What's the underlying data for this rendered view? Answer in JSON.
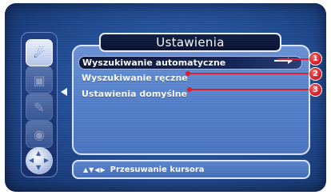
{
  "menu": {
    "title": "Ustawienia",
    "items": [
      {
        "label": "Wyszukiwanie automatyczne",
        "selected": true
      },
      {
        "label": "Wyszukiwanie ręczne",
        "selected": false
      },
      {
        "label": "Ustawienia domyślne",
        "selected": false
      }
    ]
  },
  "sidebar": {
    "icons": [
      {
        "name": "satellite-dish-icon",
        "glyph": "☄",
        "active": true
      },
      {
        "name": "tv-icon",
        "glyph": "▣",
        "active": false
      },
      {
        "name": "tools-icon",
        "glyph": "✎",
        "active": false
      },
      {
        "name": "settings-disk-icon",
        "glyph": "◉",
        "active": false
      }
    ],
    "nav_glyphs": {
      "up": "▲",
      "down": "▼",
      "left": "◀",
      "right": "▶"
    }
  },
  "status": {
    "nav_icons": "▲▼◀▶",
    "text": "Przesuwanie kursora"
  },
  "callouts": [
    "1",
    "2",
    "3"
  ],
  "colors": {
    "screen_bg": "#24519b",
    "panel_bg": "#5481cc",
    "highlight": "#0b1637",
    "callout": "#e21d2b"
  }
}
